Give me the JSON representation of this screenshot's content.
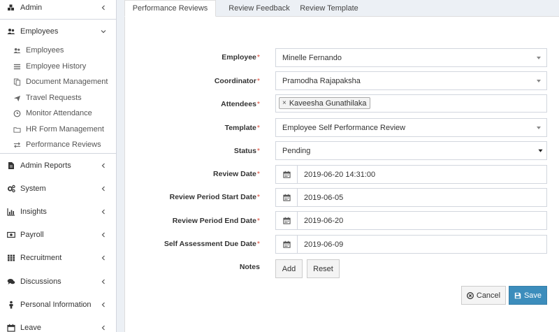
{
  "sidebar": {
    "top_items": [
      {
        "label": "Admin",
        "icon": "cubes-icon"
      },
      {
        "label": "Employees",
        "icon": "users-icon"
      }
    ],
    "employee_sub": [
      {
        "label": "Employees",
        "icon": "users-icon"
      },
      {
        "label": "Employee History",
        "icon": "list-icon"
      },
      {
        "label": "Document Management",
        "icon": "files-icon"
      },
      {
        "label": "Travel Requests",
        "icon": "plane-icon"
      },
      {
        "label": "Monitor Attendance",
        "icon": "clock-icon"
      },
      {
        "label": "HR Form Management",
        "icon": "folder-icon"
      },
      {
        "label": "Performance Reviews",
        "icon": "exchange-icon"
      }
    ],
    "bottom_items": [
      {
        "label": "Admin Reports",
        "icon": "file-icon"
      },
      {
        "label": "System",
        "icon": "cogs-icon"
      },
      {
        "label": "Insights",
        "icon": "bar-chart-icon"
      },
      {
        "label": "Payroll",
        "icon": "money-icon"
      },
      {
        "label": "Recruitment",
        "icon": "grid-icon"
      },
      {
        "label": "Discussions",
        "icon": "comments-icon"
      },
      {
        "label": "Personal Information",
        "icon": "person-icon"
      },
      {
        "label": "Leave",
        "icon": "calendar-icon"
      }
    ]
  },
  "tabs": [
    {
      "label": "Performance Reviews",
      "active": true
    },
    {
      "label": "Review Feedback",
      "active": false
    },
    {
      "label": "Review Template",
      "active": false
    }
  ],
  "form": {
    "employee": {
      "label": "Employee",
      "value": "Minelle Fernando"
    },
    "coordinator": {
      "label": "Coordinator",
      "value": "Pramodha Rajapaksha"
    },
    "attendees": {
      "label": "Attendees",
      "tags": [
        "Kaveesha Gunathilaka"
      ]
    },
    "template": {
      "label": "Template",
      "value": "Employee Self Performance Review"
    },
    "status": {
      "label": "Status",
      "value": "Pending"
    },
    "review_date": {
      "label": "Review Date",
      "value": "2019-06-20 14:31:00"
    },
    "period_start": {
      "label": "Review Period Start Date",
      "value": "2019-06-05"
    },
    "period_end": {
      "label": "Review Period End Date",
      "value": "2019-06-20"
    },
    "self_due": {
      "label": "Self Assessment Due Date",
      "value": "2019-06-09"
    },
    "notes": {
      "label": "Notes",
      "add": "Add",
      "reset": "Reset"
    },
    "required_mark": "*"
  },
  "actions": {
    "cancel": "Cancel",
    "save": "Save"
  },
  "colors": {
    "accent": "#3c8dbc",
    "required": "#dd4b39"
  }
}
